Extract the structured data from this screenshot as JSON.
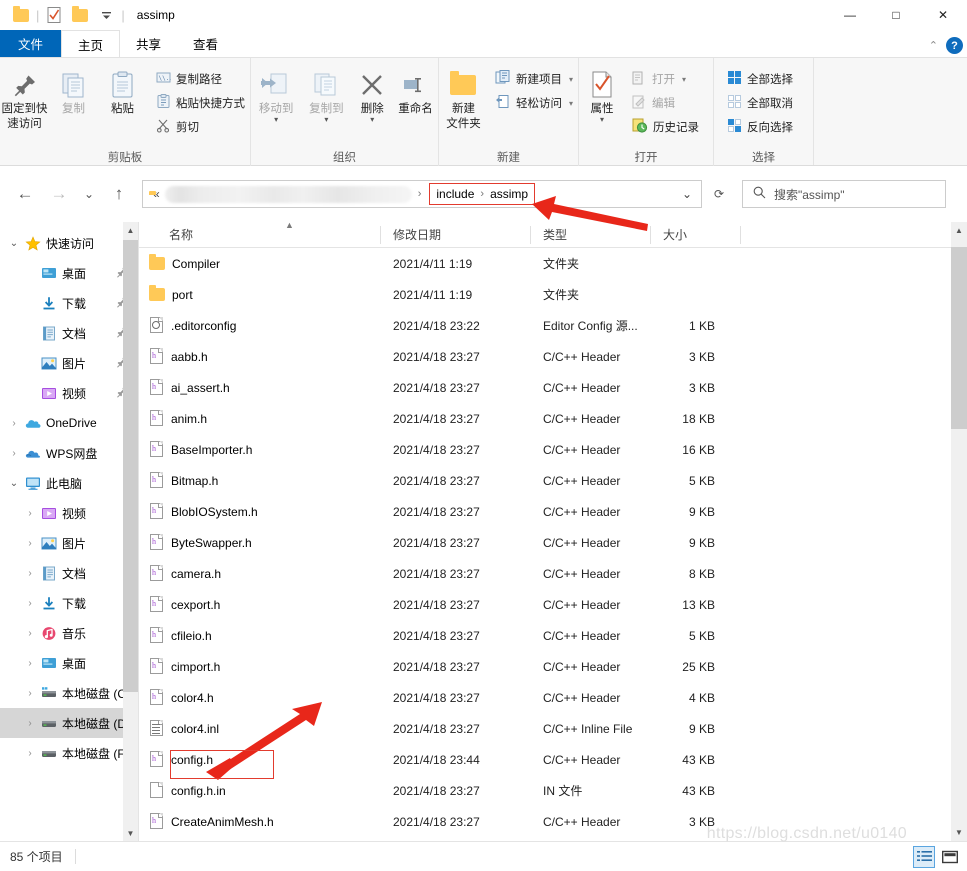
{
  "window": {
    "title": "assimp",
    "quick_access": [
      "folder-icon",
      "save-check-icon",
      "folder-icon",
      "dropdown-caret"
    ],
    "controls": {
      "minimize": "—",
      "maximize": "□",
      "close": "✕"
    }
  },
  "ribbon": {
    "tabs": [
      {
        "label": "文件",
        "type": "file"
      },
      {
        "label": "主页",
        "type": "active"
      },
      {
        "label": "共享",
        "type": "normal"
      },
      {
        "label": "查看",
        "type": "normal"
      }
    ],
    "collapse_caret": "⌃",
    "help": "?",
    "groups": [
      {
        "label": "剪贴板",
        "big": [
          {
            "label": "固定到快\n速访问",
            "icon": "pin-icon",
            "disabled": false
          },
          {
            "label": "复制",
            "icon": "copy-icon",
            "disabled": true
          },
          {
            "label": "粘贴",
            "icon": "paste-icon",
            "disabled": false
          }
        ],
        "small": [
          {
            "label": "复制路径",
            "icon": "copy-path-icon"
          },
          {
            "label": "粘贴快捷方式",
            "icon": "paste-shortcut-icon"
          },
          {
            "label": "剪切",
            "icon": "scissors-icon"
          }
        ]
      },
      {
        "label": "组织",
        "big": [
          {
            "label": "移动到",
            "icon": "move-to-icon",
            "caret": true,
            "disabled": true
          },
          {
            "label": "复制到",
            "icon": "copy-to-icon",
            "caret": true,
            "disabled": true
          },
          {
            "label": "删除",
            "icon": "delete-x-icon",
            "caret": true,
            "disabled": false
          },
          {
            "label": "重命名",
            "icon": "rename-icon",
            "disabled": false
          }
        ]
      },
      {
        "label": "新建",
        "big": [
          {
            "label": "新建\n文件夹",
            "icon": "new-folder-icon",
            "disabled": false
          }
        ],
        "small": [
          {
            "label": "新建项目",
            "icon": "new-item-icon",
            "caret": true
          },
          {
            "label": "轻松访问",
            "icon": "easy-access-icon",
            "caret": true
          }
        ]
      },
      {
        "label": "打开",
        "big": [
          {
            "label": "属性",
            "icon": "properties-icon",
            "caret": true,
            "disabled": false
          }
        ],
        "small": [
          {
            "label": "打开",
            "icon": "open-icon",
            "caret": true,
            "disabled": true
          },
          {
            "label": "编辑",
            "icon": "edit-icon",
            "disabled": true
          },
          {
            "label": "历史记录",
            "icon": "history-icon",
            "disabled": false
          }
        ]
      },
      {
        "label": "选择",
        "small": [
          {
            "label": "全部选择",
            "icon": "select-all-icon"
          },
          {
            "label": "全部取消",
            "icon": "select-none-icon"
          },
          {
            "label": "反向选择",
            "icon": "invert-selection-icon"
          }
        ]
      }
    ]
  },
  "address": {
    "back": "←",
    "forward": "→",
    "recent": "⌄",
    "up": "↑",
    "path_hidden": "«",
    "breadcrumbs": [
      "include",
      "assimp"
    ],
    "breadcrumb_separator": "›",
    "dropdown": "⌄",
    "refresh": "⟳",
    "search_placeholder": "搜索\"assimp\""
  },
  "navpane": {
    "items": [
      {
        "label": "快速访问",
        "icon": "star-icon",
        "expander": "open",
        "indent": 0,
        "pinned": false,
        "selected": false
      },
      {
        "label": "桌面",
        "icon": "desktop-icon",
        "expander": "none",
        "indent": 1,
        "pinned": true,
        "selected": false
      },
      {
        "label": "下载",
        "icon": "downloads-icon",
        "expander": "none",
        "indent": 1,
        "pinned": true,
        "selected": false
      },
      {
        "label": "文档",
        "icon": "documents-icon",
        "expander": "none",
        "indent": 1,
        "pinned": true,
        "selected": false
      },
      {
        "label": "图片",
        "icon": "pictures-icon",
        "expander": "none",
        "indent": 1,
        "pinned": true,
        "selected": false
      },
      {
        "label": "视频",
        "icon": "videos-icon",
        "expander": "none",
        "indent": 1,
        "pinned": true,
        "selected": false
      },
      {
        "label": "OneDrive",
        "icon": "onedrive-icon",
        "expander": "closed",
        "indent": 0,
        "pinned": false,
        "selected": false
      },
      {
        "label": "WPS网盘",
        "icon": "wps-cloud-icon",
        "expander": "closed",
        "indent": 0,
        "pinned": false,
        "selected": false
      },
      {
        "label": "此电脑",
        "icon": "this-pc-icon",
        "expander": "open",
        "indent": 0,
        "pinned": false,
        "selected": false
      },
      {
        "label": "视频",
        "icon": "videos-icon",
        "expander": "closed",
        "indent": 1,
        "pinned": false,
        "selected": false
      },
      {
        "label": "图片",
        "icon": "pictures-icon",
        "expander": "closed",
        "indent": 1,
        "pinned": false,
        "selected": false
      },
      {
        "label": "文档",
        "icon": "documents-icon",
        "expander": "closed",
        "indent": 1,
        "pinned": false,
        "selected": false
      },
      {
        "label": "下载",
        "icon": "downloads-icon",
        "expander": "closed",
        "indent": 1,
        "pinned": false,
        "selected": false
      },
      {
        "label": "音乐",
        "icon": "music-icon",
        "expander": "closed",
        "indent": 1,
        "pinned": false,
        "selected": false
      },
      {
        "label": "桌面",
        "icon": "desktop-icon",
        "expander": "closed",
        "indent": 1,
        "pinned": false,
        "selected": false
      },
      {
        "label": "本地磁盘 (C:)",
        "icon": "system-drive-icon",
        "expander": "closed",
        "indent": 1,
        "pinned": false,
        "selected": false
      },
      {
        "label": "本地磁盘 (D:)",
        "icon": "drive-icon",
        "expander": "closed",
        "indent": 1,
        "pinned": false,
        "selected": true
      },
      {
        "label": "本地磁盘 (F:)",
        "icon": "drive-icon",
        "expander": "closed",
        "indent": 1,
        "pinned": false,
        "selected": false
      }
    ]
  },
  "filelist": {
    "columns": [
      "名称",
      "修改日期",
      "类型",
      "大小"
    ],
    "sort_column": "名称",
    "sort_direction": "asc",
    "rows": [
      {
        "name": "Compiler",
        "date": "2021/4/11 1:19",
        "type": "文件夹",
        "size": "",
        "icon": "folder-icon"
      },
      {
        "name": "port",
        "date": "2021/4/11 1:19",
        "type": "文件夹",
        "size": "",
        "icon": "folder-icon"
      },
      {
        "name": ".editorconfig",
        "date": "2021/4/18 23:22",
        "type": "Editor Config 源...",
        "size": "1 KB",
        "icon": "config-file-icon"
      },
      {
        "name": "aabb.h",
        "date": "2021/4/18 23:27",
        "type": "C/C++ Header",
        "size": "3 KB",
        "icon": "header-file-icon"
      },
      {
        "name": "ai_assert.h",
        "date": "2021/4/18 23:27",
        "type": "C/C++ Header",
        "size": "3 KB",
        "icon": "header-file-icon"
      },
      {
        "name": "anim.h",
        "date": "2021/4/18 23:27",
        "type": "C/C++ Header",
        "size": "18 KB",
        "icon": "header-file-icon"
      },
      {
        "name": "BaseImporter.h",
        "date": "2021/4/18 23:27",
        "type": "C/C++ Header",
        "size": "16 KB",
        "icon": "header-file-icon"
      },
      {
        "name": "Bitmap.h",
        "date": "2021/4/18 23:27",
        "type": "C/C++ Header",
        "size": "5 KB",
        "icon": "header-file-icon"
      },
      {
        "name": "BlobIOSystem.h",
        "date": "2021/4/18 23:27",
        "type": "C/C++ Header",
        "size": "9 KB",
        "icon": "header-file-icon"
      },
      {
        "name": "ByteSwapper.h",
        "date": "2021/4/18 23:27",
        "type": "C/C++ Header",
        "size": "9 KB",
        "icon": "header-file-icon"
      },
      {
        "name": "camera.h",
        "date": "2021/4/18 23:27",
        "type": "C/C++ Header",
        "size": "8 KB",
        "icon": "header-file-icon"
      },
      {
        "name": "cexport.h",
        "date": "2021/4/18 23:27",
        "type": "C/C++ Header",
        "size": "13 KB",
        "icon": "header-file-icon"
      },
      {
        "name": "cfileio.h",
        "date": "2021/4/18 23:27",
        "type": "C/C++ Header",
        "size": "5 KB",
        "icon": "header-file-icon"
      },
      {
        "name": "cimport.h",
        "date": "2021/4/18 23:27",
        "type": "C/C++ Header",
        "size": "25 KB",
        "icon": "header-file-icon"
      },
      {
        "name": "color4.h",
        "date": "2021/4/18 23:27",
        "type": "C/C++ Header",
        "size": "4 KB",
        "icon": "header-file-icon"
      },
      {
        "name": "color4.inl",
        "date": "2021/4/18 23:27",
        "type": "C/C++ Inline File",
        "size": "9 KB",
        "icon": "inline-file-icon"
      },
      {
        "name": "config.h",
        "date": "2021/4/18 23:44",
        "type": "C/C++ Header",
        "size": "43 KB",
        "icon": "header-file-icon",
        "highlighted": true
      },
      {
        "name": "config.h.in",
        "date": "2021/4/18 23:27",
        "type": "IN 文件",
        "size": "43 KB",
        "icon": "plain-file-icon"
      },
      {
        "name": "CreateAnimMesh.h",
        "date": "2021/4/18 23:27",
        "type": "C/C++ Header",
        "size": "3 KB",
        "icon": "header-file-icon"
      }
    ]
  },
  "status": {
    "item_count": "85 个项目"
  },
  "view_buttons": [
    {
      "name": "details-view",
      "active": true
    },
    {
      "name": "large-icons-view",
      "active": false
    }
  ],
  "watermark": "https://blog.csdn.net/u0140",
  "colors": {
    "file_tab_blue": "#0066b8",
    "annotation_red": "#e23b2e",
    "folder_yellow": "#ffc957",
    "selection_gray": "#d6d6d6",
    "header_icon_purple": "#a14fd0"
  }
}
